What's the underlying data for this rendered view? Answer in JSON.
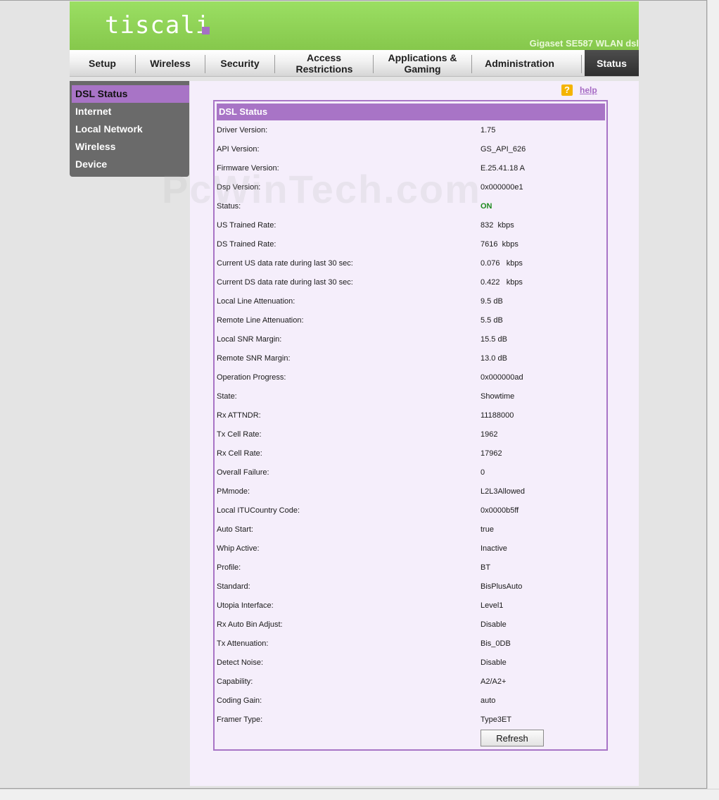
{
  "header": {
    "logo_text": "tiscali",
    "model": "Gigaset SE587 WLAN dsl"
  },
  "nav": {
    "tabs": [
      {
        "label": "Setup"
      },
      {
        "label": "Wireless"
      },
      {
        "label": "Security"
      },
      {
        "label": "Access Restrictions"
      },
      {
        "label": "Applications & Gaming"
      },
      {
        "label": "Administration"
      },
      {
        "label": "Status"
      }
    ],
    "active_tab": "Status"
  },
  "sidebar": {
    "items": [
      {
        "label": "DSL Status"
      },
      {
        "label": "Internet"
      },
      {
        "label": "Local Network"
      },
      {
        "label": "Wireless"
      },
      {
        "label": "Device"
      }
    ],
    "active_item": "DSL Status"
  },
  "help": {
    "icon": "?",
    "label": "help"
  },
  "panel": {
    "title": "DSL Status",
    "rows": [
      {
        "label": "Driver Version:",
        "value": "1.75"
      },
      {
        "label": "API Version:",
        "value": "GS_API_626"
      },
      {
        "label": "Firmware Version:",
        "value": "E.25.41.18 A"
      },
      {
        "label": "Dsp Version:",
        "value": "0x000000e1"
      },
      {
        "label": "Status:",
        "value": "ON"
      },
      {
        "label": "US Trained Rate:",
        "value": "832  kbps"
      },
      {
        "label": "DS Trained Rate:",
        "value": "7616  kbps"
      },
      {
        "label": "Current US data rate during last 30 sec:",
        "value": "0.076   kbps"
      },
      {
        "label": "Current DS data rate during last 30 sec:",
        "value": "0.422   kbps"
      },
      {
        "label": "Local Line Attenuation:",
        "value": "9.5 dB"
      },
      {
        "label": "Remote Line Attenuation:",
        "value": "5.5 dB"
      },
      {
        "label": "Local SNR Margin:",
        "value": "15.5 dB"
      },
      {
        "label": "Remote SNR Margin:",
        "value": "13.0 dB"
      },
      {
        "label": "Operation Progress:",
        "value": "0x000000ad"
      },
      {
        "label": "State:",
        "value": "Showtime"
      },
      {
        "label": "Rx ATTNDR:",
        "value": "11188000"
      },
      {
        "label": "Tx Cell Rate:",
        "value": "1962"
      },
      {
        "label": "Rx Cell Rate:",
        "value": "17962"
      },
      {
        "label": "Overall Failure:",
        "value": "0"
      },
      {
        "label": "PMmode:",
        "value": "L2L3Allowed"
      },
      {
        "label": "Local ITUCountry Code:",
        "value": "0x0000b5ff"
      },
      {
        "label": "Auto Start:",
        "value": "true"
      },
      {
        "label": "Whip Active:",
        "value": "Inactive"
      },
      {
        "label": "Profile:",
        "value": "BT"
      },
      {
        "label": "Standard:",
        "value": "BisPlusAuto"
      },
      {
        "label": "Utopia Interface:",
        "value": "Level1"
      },
      {
        "label": "Rx Auto Bin Adjust:",
        "value": "Disable"
      },
      {
        "label": "Tx Attenuation:",
        "value": "Bis_0DB"
      },
      {
        "label": "Detect Noise:",
        "value": "Disable"
      },
      {
        "label": "Capability:",
        "value": "A2/A2+"
      },
      {
        "label": "Coding Gain:",
        "value": "auto"
      },
      {
        "label": "Framer Type:",
        "value": "Type3ET"
      }
    ],
    "refresh_label": "Refresh"
  },
  "watermark": "PcWinTech.com",
  "colors": {
    "header_green": "#8ed155",
    "accent_purple": "#a874c6",
    "status_on_green": "#1d8a1d",
    "sidebar_gray": "#6a6a6a",
    "content_bg": "#f5eefb"
  }
}
